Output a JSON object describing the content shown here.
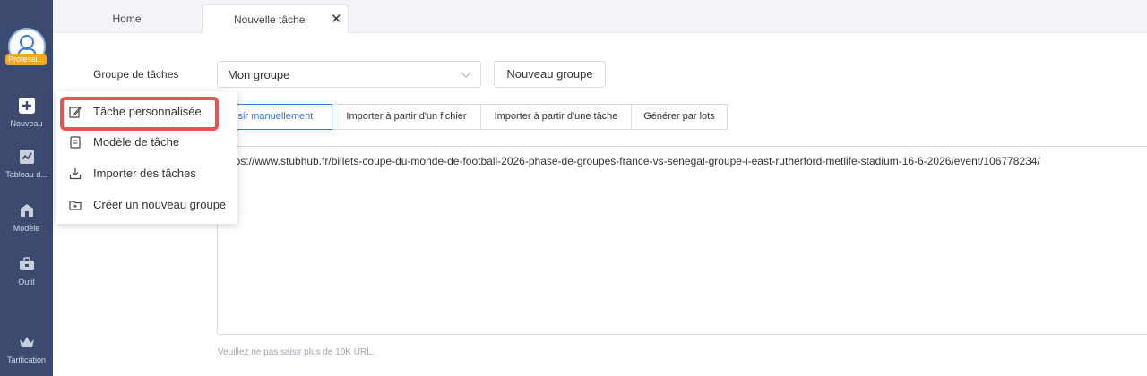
{
  "sidebar": {
    "plan_badge": "Professi...",
    "items": [
      {
        "label": "Nouveau",
        "icon": "plus-square-icon"
      },
      {
        "label": "Tableau d...",
        "icon": "dashboard-icon"
      },
      {
        "label": "Modèle",
        "icon": "template-icon"
      },
      {
        "label": "Outil",
        "icon": "toolbox-icon"
      },
      {
        "label": "Tarification",
        "icon": "crown-icon"
      }
    ]
  },
  "tabs": {
    "home": "Home",
    "new_task": "Nouvelle tâche",
    "close_icon": "✕"
  },
  "form": {
    "group_label": "Groupe de tâches",
    "group_value": "Mon groupe",
    "new_group_button": "Nouveau groupe",
    "input_modes": [
      {
        "label": "aisir manuellement",
        "active": true
      },
      {
        "label": "Importer à partir d'un fichier",
        "active": false
      },
      {
        "label": "Importer à partir d'une tâche",
        "active": false
      },
      {
        "label": "Générer par lots",
        "active": false
      }
    ],
    "url_value": "ttps://www.stubhub.fr/billets-coupe-du-monde-de-football-2026-phase-de-groupes-france-vs-senegal-groupe-i-east-rutherford-metlife-stadium-16-6-2026/event/106778234/",
    "hint": "Veuillez ne pas saisir plus de 10K URL."
  },
  "menu": {
    "items": [
      {
        "label": "Tâche personnalisée",
        "icon": "edit-icon"
      },
      {
        "label": "Modèle de tâche",
        "icon": "template-doc-icon"
      },
      {
        "label": "Importer des tâches",
        "icon": "import-icon"
      },
      {
        "label": "Créer un nouveau groupe",
        "icon": "new-folder-icon"
      }
    ]
  },
  "colors": {
    "sidebar_bg": "#3b4a6e",
    "accent": "#3a78d6",
    "badge": "#f5a623",
    "highlight": "#e35454"
  }
}
